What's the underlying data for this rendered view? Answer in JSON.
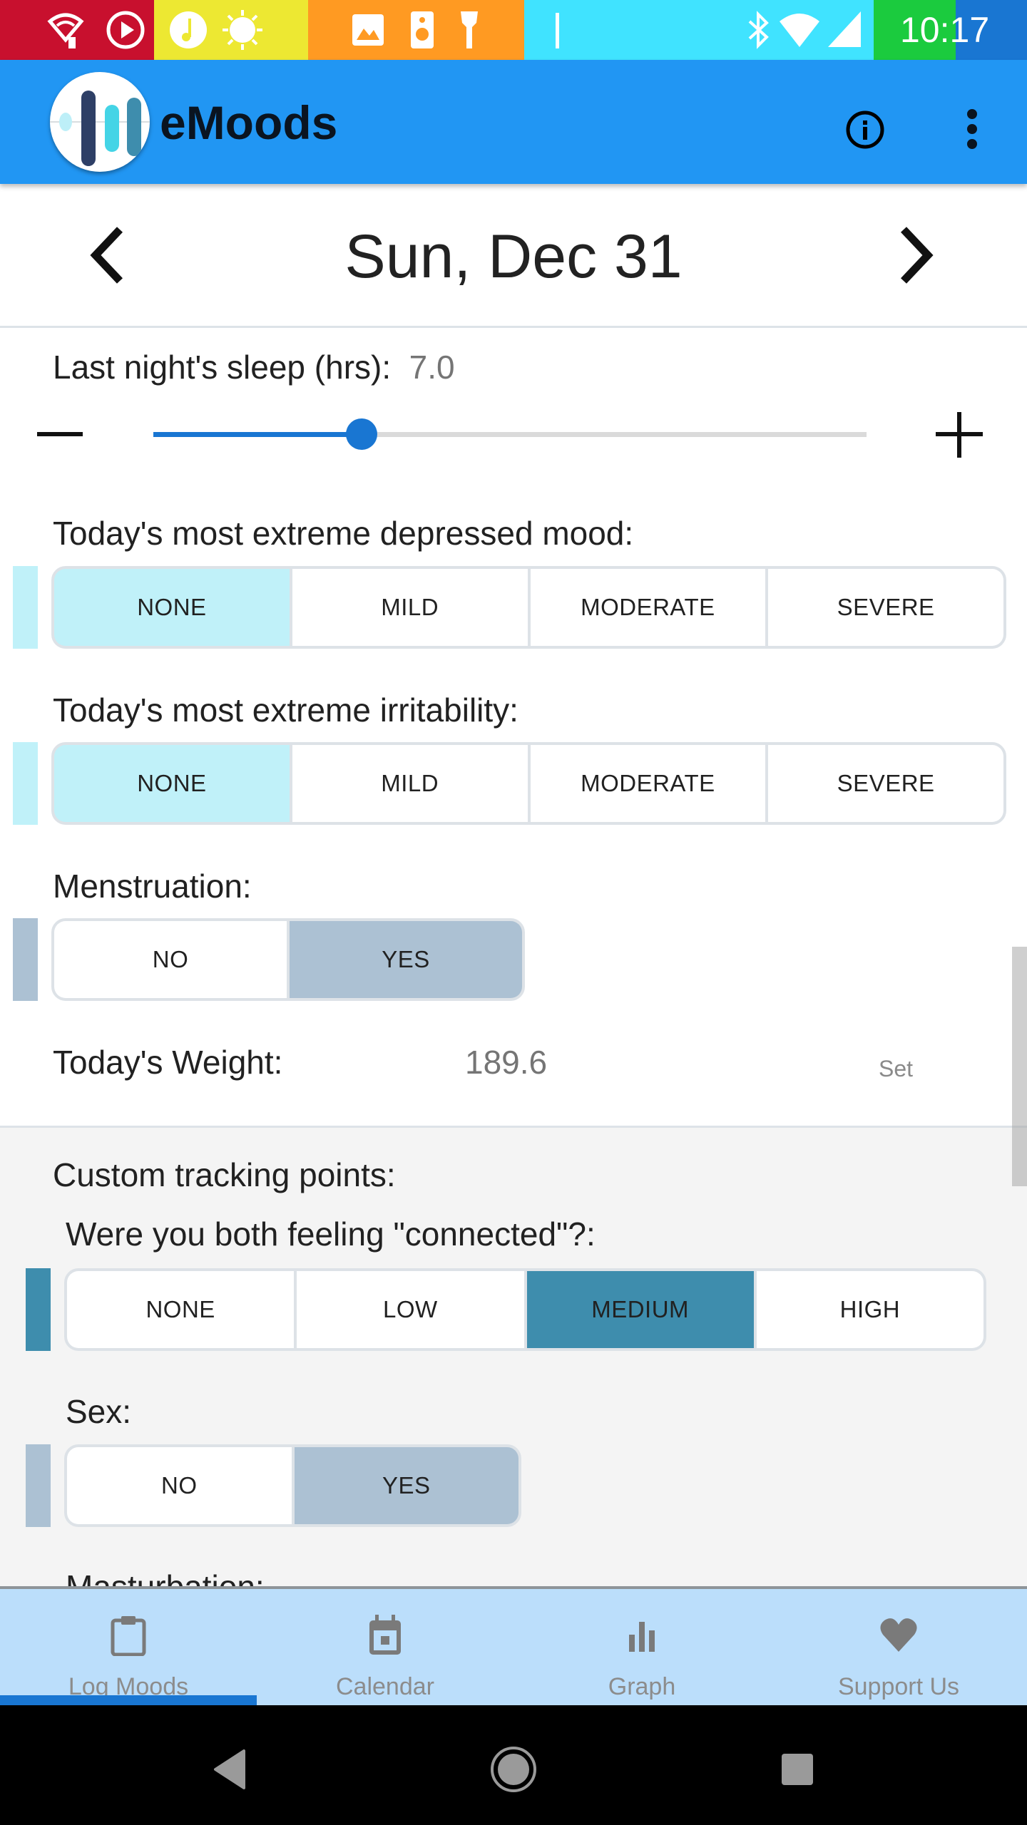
{
  "status_bar": {
    "time": "10:17",
    "segment_colors": [
      "#C8102E",
      "#EDE832",
      "#FF9A22",
      "#40E3FF",
      "#1BCB3E",
      "#1976D2"
    ],
    "icons": [
      "wifi-call-icon",
      "play-icon",
      "music-icon",
      "brightness-icon",
      "image-icon",
      "speaker-icon",
      "flashlight-icon",
      "bar-icon",
      "bluetooth-icon",
      "wifi-icon",
      "signal-icon"
    ]
  },
  "app_bar": {
    "title": "eMoods",
    "color": "#2196F3",
    "actions": [
      "info-icon",
      "more-vert-icon"
    ]
  },
  "date_nav": {
    "date": "Sun, Dec 31",
    "prev_icon": "chevron-left-icon",
    "next_icon": "chevron-right-icon"
  },
  "sleep": {
    "label": "Last night's sleep (hrs):",
    "value": "7.0",
    "min": 0,
    "max": 24,
    "current": 7.0,
    "decrement_icon": "minus-icon",
    "increment_icon": "plus-icon",
    "accent": "#1976D2"
  },
  "depressed": {
    "label": "Today's most extreme depressed mood:",
    "options": [
      "NONE",
      "MILD",
      "MODERATE",
      "SEVERE"
    ],
    "selected": 0,
    "selected_color": "#C0F1F9"
  },
  "irritability": {
    "label": "Today's most extreme irritability:",
    "options": [
      "NONE",
      "MILD",
      "MODERATE",
      "SEVERE"
    ],
    "selected": 0,
    "selected_color": "#C0F1F9"
  },
  "menstruation": {
    "label": "Menstruation:",
    "options": [
      "NO",
      "YES"
    ],
    "selected": 1,
    "selected_color": "#ACC1D3"
  },
  "weight": {
    "label": "Today's Weight:",
    "value": "189.6",
    "set_label": "Set"
  },
  "custom": {
    "title": "Custom tracking points:",
    "connected": {
      "label": "Were you both feeling \"connected\"?:",
      "options": [
        "NONE",
        "LOW",
        "MEDIUM",
        "HIGH"
      ],
      "selected": 2,
      "selected_color": "#3E8DAD"
    },
    "sex": {
      "label": "Sex:",
      "options": [
        "NO",
        "YES"
      ],
      "selected": 1,
      "selected_color": "#ACC1D3"
    },
    "masturbation": {
      "label": "Masturbation:"
    }
  },
  "bottom_nav": {
    "items": [
      {
        "label": "Log Moods",
        "icon": "clipboard-icon",
        "active": true
      },
      {
        "label": "Calendar",
        "icon": "calendar-icon",
        "active": false
      },
      {
        "label": "Graph",
        "icon": "bar-chart-icon",
        "active": false
      },
      {
        "label": "Support Us",
        "icon": "heart-icon",
        "active": false
      }
    ]
  },
  "system_nav": {
    "buttons": [
      "back-icon",
      "home-icon",
      "recents-icon"
    ]
  }
}
